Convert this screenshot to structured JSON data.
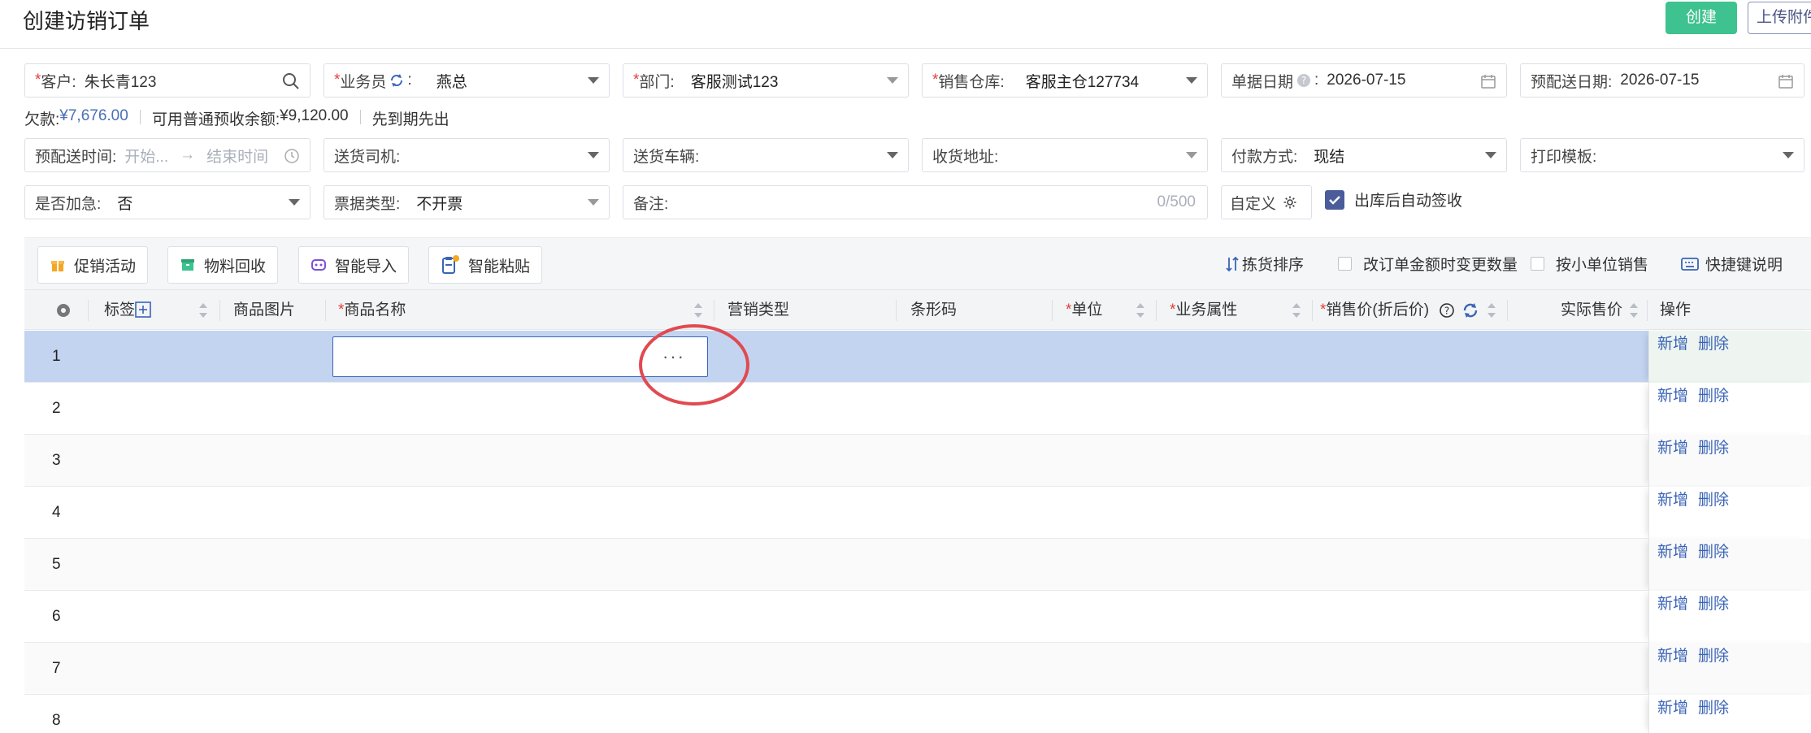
{
  "header": {
    "title": "创建访销订单",
    "create_label": "创建",
    "upload_label": "上传附件"
  },
  "form": {
    "row1": [
      {
        "required": true,
        "label": "客户:",
        "value": "朱长青123",
        "icon": "search-icon"
      },
      {
        "required": true,
        "label": "业务员",
        "suffix": ":",
        "value": "燕总",
        "icon": "refresh-icon"
      },
      {
        "required": true,
        "label": "部门:",
        "value": "客服测试123"
      },
      {
        "required": true,
        "label": "销售仓库:",
        "value": "客服主仓127734"
      },
      {
        "required": false,
        "label": "单据日期",
        "suffix": ":",
        "value": "2026-07-15",
        "icon": "help-icon"
      },
      {
        "required": false,
        "label": "预配送日期:",
        "value": "2026-07-15"
      }
    ],
    "info": {
      "debt_label": "欠款:",
      "debt_value": "¥7,676.00",
      "prepay_label": "可用普通预收余额:",
      "prepay_value": "¥9,120.00",
      "fifo": "先到期先出"
    },
    "row2": [
      {
        "label": "预配送时间:",
        "start_placeholder": "开始...",
        "end_placeholder": "结束时间"
      },
      {
        "label": "送货司机:",
        "value": ""
      },
      {
        "label": "送货车辆:",
        "value": ""
      },
      {
        "label": "收货地址:",
        "value": ""
      },
      {
        "label": "付款方式:",
        "value": "现结"
      },
      {
        "label": "打印模板:",
        "value": ""
      }
    ],
    "row3": [
      {
        "label": "是否加急:",
        "value": "否"
      },
      {
        "label": "票据类型:",
        "value": "不开票"
      },
      {
        "label": "备注:",
        "counter": "0/500"
      },
      {
        "label": "自定义"
      },
      {
        "label": "出库后自动签收",
        "checked": true
      }
    ]
  },
  "toolbar": {
    "buttons": [
      {
        "label": "促销活动",
        "icon": "gift-icon"
      },
      {
        "label": "物料回收",
        "icon": "box-icon"
      },
      {
        "label": "智能导入",
        "icon": "robot-icon"
      },
      {
        "label": "智能粘贴",
        "icon": "clipboard-icon"
      }
    ],
    "right": {
      "pick_sort": "拣货排序",
      "change_qty": "改订单金额时变更数量",
      "small_unit": "按小单位销售",
      "shortcut": "快捷键说明"
    }
  },
  "table": {
    "columns": {
      "tag": "标签",
      "image": "商品图片",
      "name": "商品名称",
      "mkt_type": "营销类型",
      "barcode": "条形码",
      "unit": "单位",
      "biz_attr": "业务属性",
      "price": "销售价(折后价)",
      "actual_price": "实际售价",
      "ops": "操作"
    },
    "rows": [
      "1",
      "2",
      "3",
      "4",
      "5",
      "6",
      "7",
      "8"
    ],
    "row_add": "新增",
    "row_delete": "删除",
    "more_dots": "···"
  },
  "colors": {
    "accent": "#3ec28f",
    "link": "#3a64b6",
    "required": "#e23c39",
    "selected_row": "#c3d4f1",
    "annotation": "#e04a50"
  }
}
